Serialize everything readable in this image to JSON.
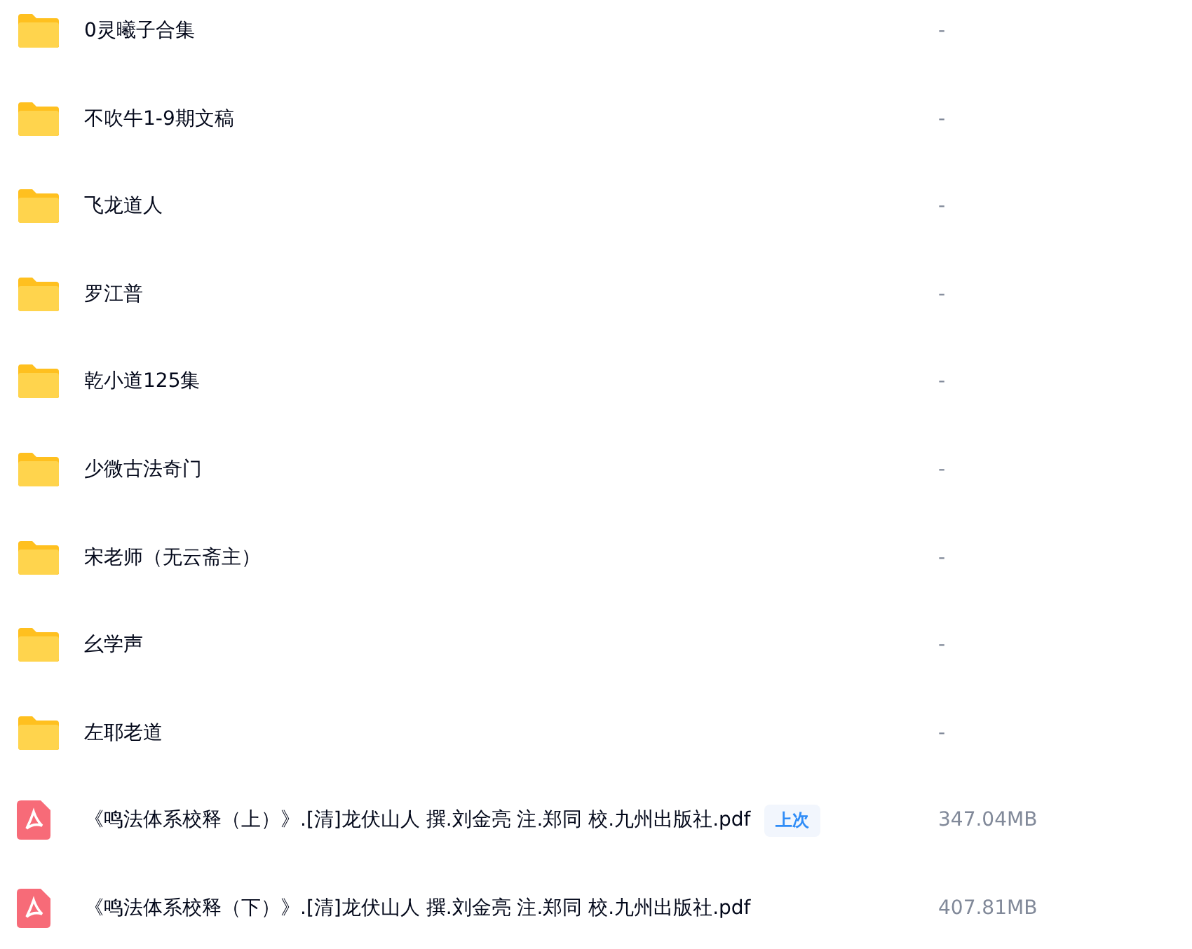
{
  "files": [
    {
      "kind": "folder",
      "name": "0灵曦子合集",
      "size": "-"
    },
    {
      "kind": "folder",
      "name": "不吹牛1-9期文稿",
      "size": "-"
    },
    {
      "kind": "folder",
      "name": "飞龙道人",
      "size": "-"
    },
    {
      "kind": "folder",
      "name": "罗江普",
      "size": "-"
    },
    {
      "kind": "folder",
      "name": "乾小道125集",
      "size": "-"
    },
    {
      "kind": "folder",
      "name": "少微古法奇门",
      "size": "-"
    },
    {
      "kind": "folder",
      "name": "宋老师（无云斋主）",
      "size": "-"
    },
    {
      "kind": "folder",
      "name": "幺学声",
      "size": "-"
    },
    {
      "kind": "folder",
      "name": "左耶老道",
      "size": "-"
    },
    {
      "kind": "pdf",
      "name": "《鸣法体系校释（上）》.[清]龙伏山人 撰.刘金亮 注.郑同 校.九州出版社.pdf",
      "badge": "上次",
      "size": "347.04MB"
    },
    {
      "kind": "pdf",
      "name": "《鸣法体系校释（下）》.[清]龙伏山人 撰.刘金亮 注.郑同 校.九州出版社.pdf",
      "size": "407.81MB"
    }
  ]
}
